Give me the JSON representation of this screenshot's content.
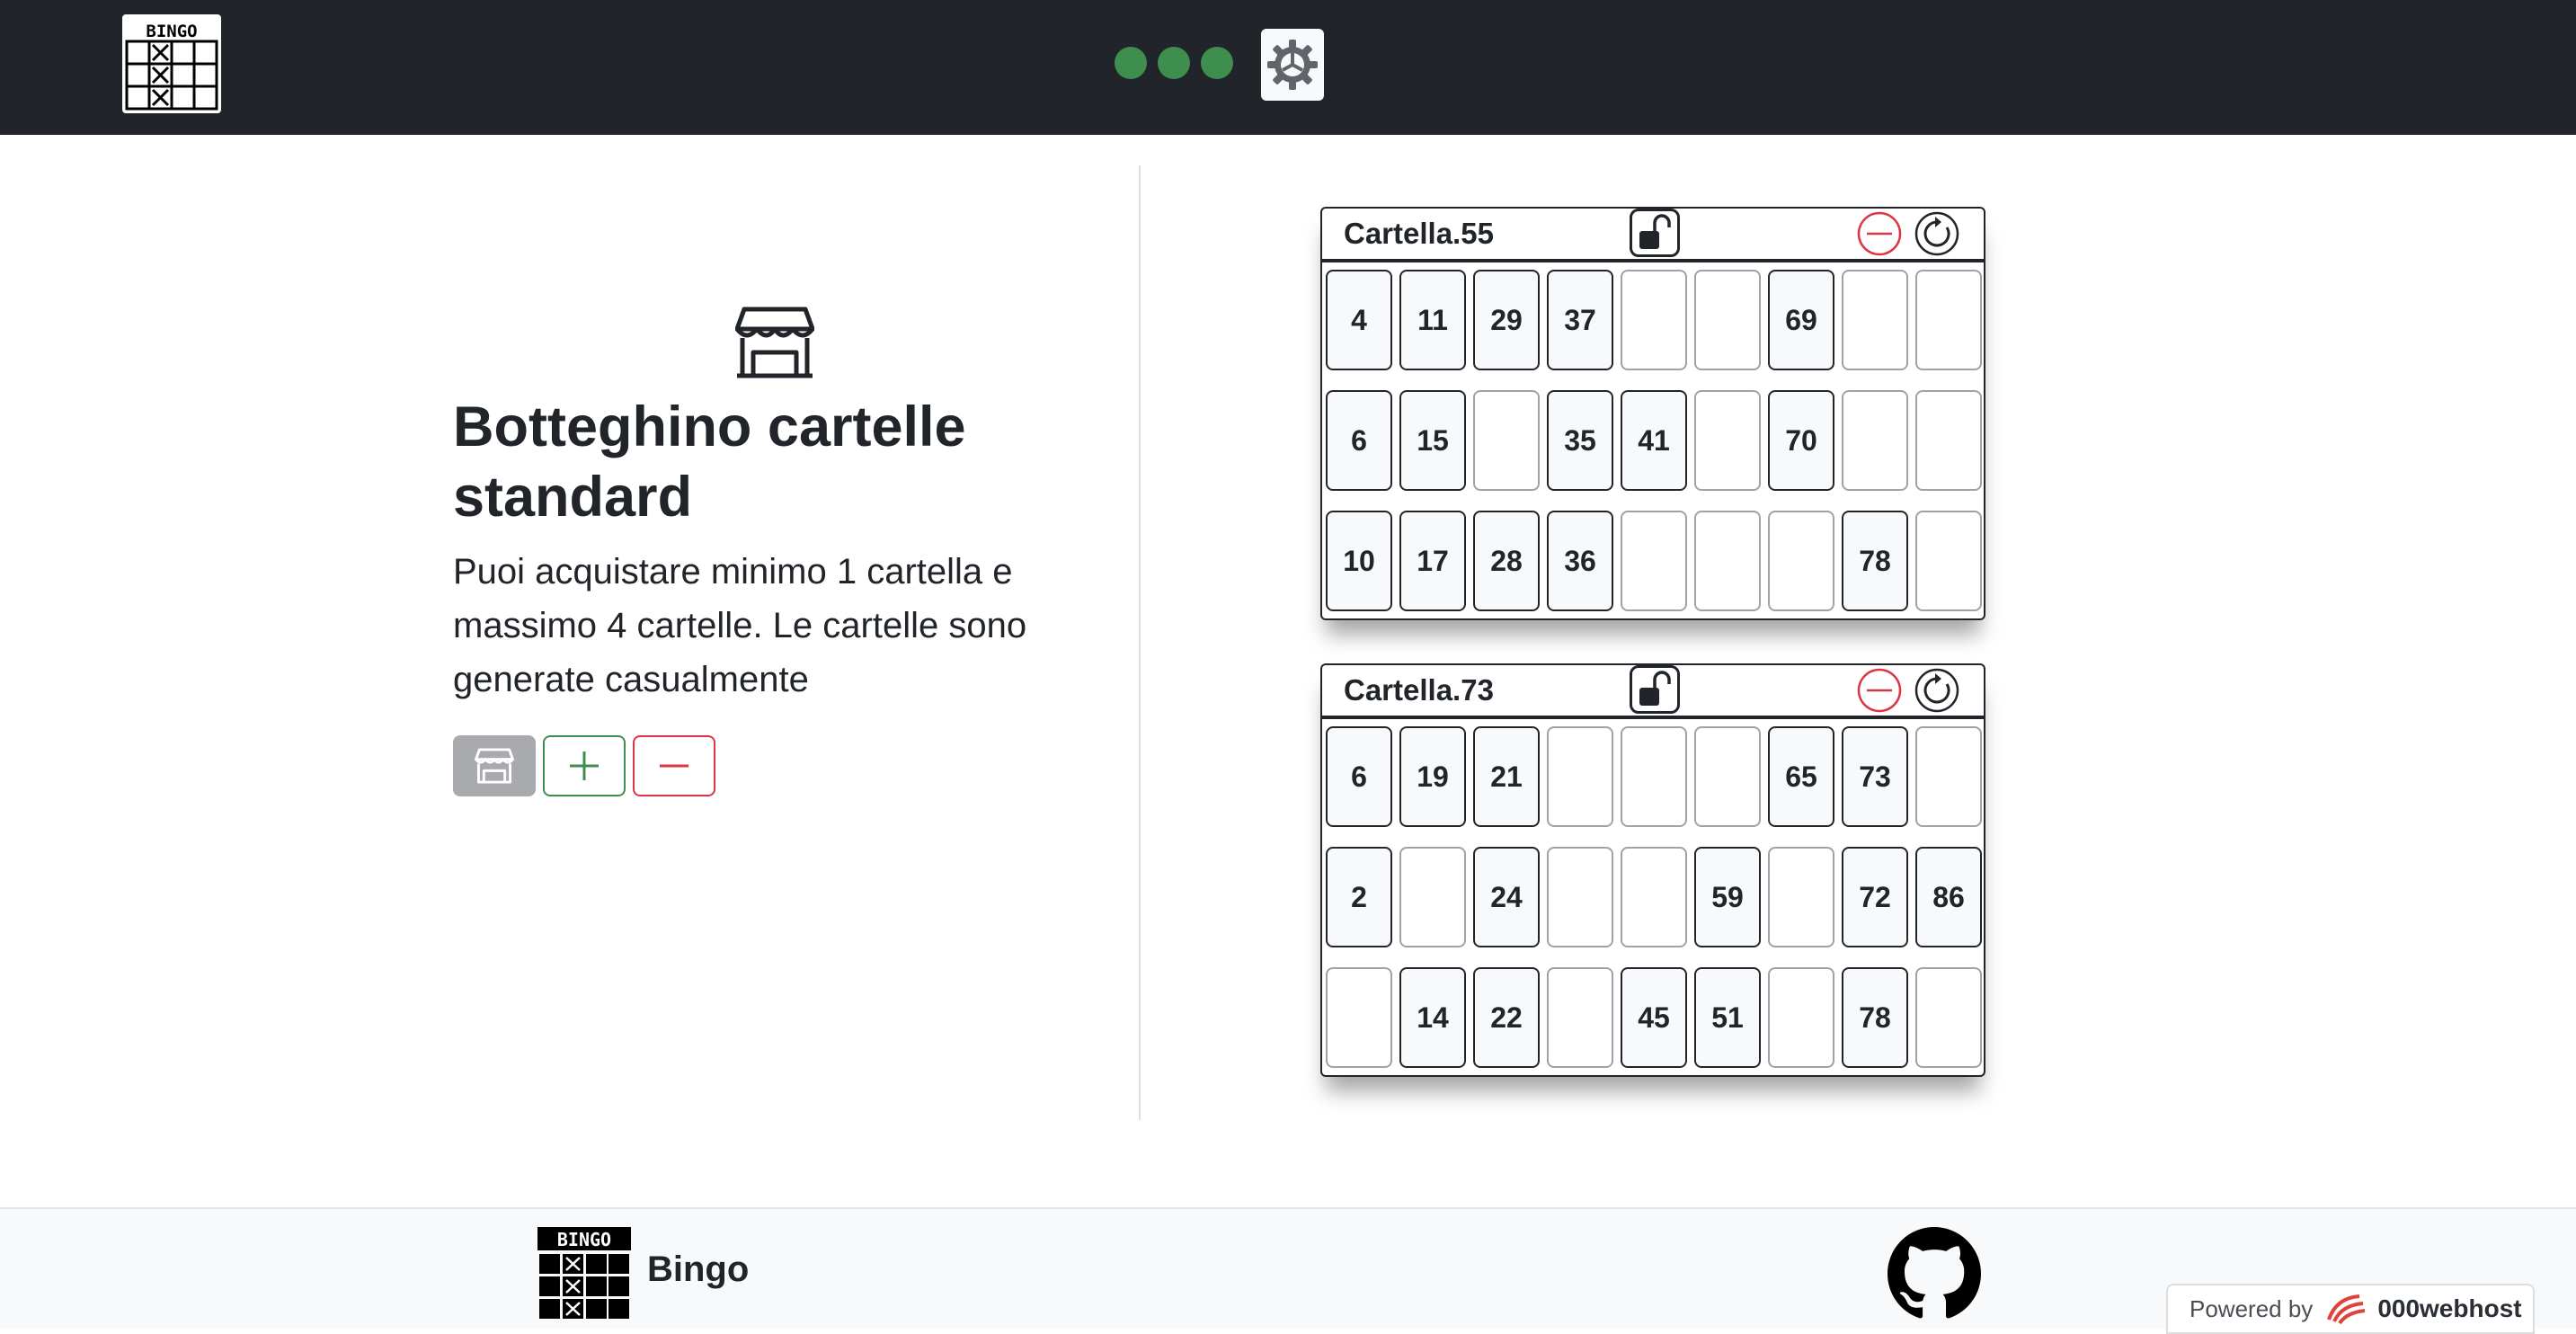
{
  "header": {
    "logo_icon": "bingo-logo-icon",
    "logo_text": "BINGO",
    "status_dots": [
      {
        "name": "status-dot-1",
        "color": "#3e8e50"
      },
      {
        "name": "status-dot-2",
        "color": "#3e8e50"
      },
      {
        "name": "status-dot-3",
        "color": "#3e8e50"
      }
    ],
    "settings_icon": "gear-icon"
  },
  "shop": {
    "icon": "shop-icon",
    "title": "Botteghino cartelle standard",
    "description": "Puoi acquistare minimo 1 cartella e massimo 4 cartelle. Le cartelle sono generate casualmente",
    "buttons": {
      "buy_icon": "shop-icon",
      "add_icon": "plus-icon",
      "remove_icon": "minus-icon"
    }
  },
  "cards": [
    {
      "title": "Cartella.55",
      "rows": [
        [
          "4",
          "11",
          "29",
          "37",
          "",
          "",
          "69",
          "",
          ""
        ],
        [
          "6",
          "15",
          "",
          "35",
          "41",
          "",
          "70",
          "",
          ""
        ],
        [
          "10",
          "17",
          "28",
          "36",
          "",
          "",
          "",
          "78",
          ""
        ]
      ]
    },
    {
      "title": "Cartella.73",
      "rows": [
        [
          "6",
          "19",
          "21",
          "",
          "",
          "",
          "65",
          "73",
          ""
        ],
        [
          "2",
          "",
          "24",
          "",
          "",
          "59",
          "",
          "72",
          "86"
        ],
        [
          "",
          "14",
          "22",
          "",
          "45",
          "51",
          "",
          "78",
          ""
        ]
      ]
    }
  ],
  "footer": {
    "logo_text": "BINGO",
    "brand": "Bingo",
    "github_icon": "github-icon",
    "powered_by": "Powered by",
    "host_brand": "000webhost"
  },
  "colors": {
    "navbar": "#212529",
    "success": "#3e8e50",
    "danger": "#dc3545",
    "muted": "#a8aaad"
  }
}
